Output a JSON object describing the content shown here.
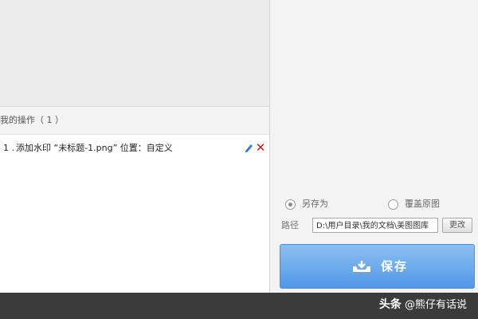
{
  "ops": {
    "header": "我的操作（ 1 ）",
    "items": [
      {
        "index": "1 .",
        "text": "添加水印 “未标题-1.png” 位置：自定义"
      }
    ]
  },
  "save": {
    "option_save_as": "另存为",
    "option_overwrite": "覆盖原图",
    "selected": "另存为",
    "path_label": "路径",
    "path_value": "D:\\用户目录\\我的文档\\美图图库",
    "change_label": "更改",
    "button_label": "保存"
  },
  "watermark": {
    "platform": "头条",
    "author": "@熊仔有话说"
  },
  "colors": {
    "save_button": "#5a9fe9",
    "delete_icon": "#d01515",
    "edit_icon": "#2f7fd6",
    "bottom_bar": "#3b3b3b"
  },
  "icons": {
    "edit": "pencil-icon",
    "delete": "close-icon",
    "save": "tray-save-icon"
  }
}
